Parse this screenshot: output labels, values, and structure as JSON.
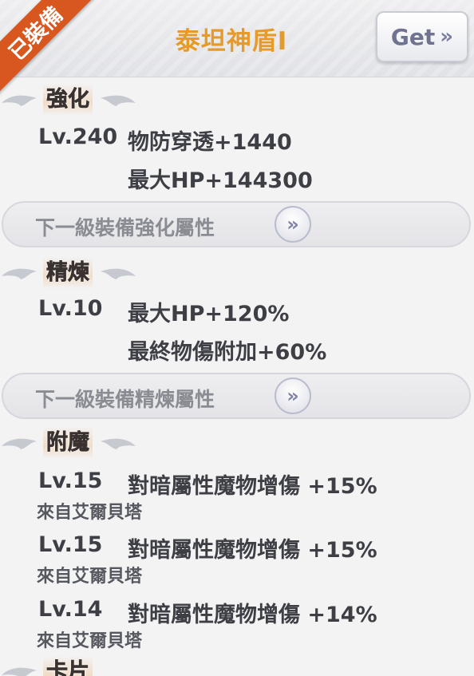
{
  "header": {
    "title": "泰坦神盾Ⅰ",
    "get_label": "Get",
    "get_icon": "»",
    "equipped_badge": "已裝備"
  },
  "colors": {
    "title": "#e69a2a",
    "ribbon": "#d8571f",
    "text": "#3d3f45"
  },
  "enhance": {
    "title": "強化",
    "level": "Lv.240",
    "stats": [
      "物防穿透+1440",
      "最大HP+144300"
    ],
    "next_label": "下一級裝備強化屬性",
    "next_icon": "»"
  },
  "refine": {
    "title": "精煉",
    "level": "Lv.10",
    "stats": [
      "最大HP+120%",
      "最終物傷附加+60%"
    ],
    "next_label": "下一級裝備精煉屬性",
    "next_icon": "»"
  },
  "enchant": {
    "title": "附魔",
    "entries": [
      {
        "level": "Lv.15",
        "effect": "對暗屬性魔物增傷 +15%",
        "source": "來自艾爾貝塔"
      },
      {
        "level": "Lv.15",
        "effect": "對暗屬性魔物增傷 +15%",
        "source": "來自艾爾貝塔"
      },
      {
        "level": "Lv.14",
        "effect": "對暗屬性魔物增傷 +14%",
        "source": "來自艾爾貝塔"
      }
    ]
  },
  "card": {
    "title": "卡片"
  }
}
